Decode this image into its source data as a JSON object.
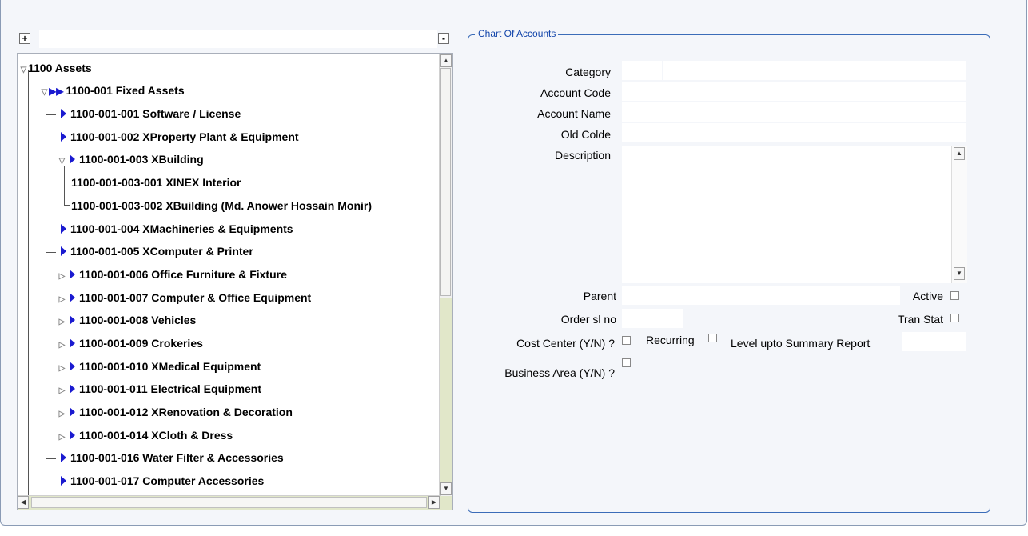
{
  "tree": {
    "expand_all_label": "+",
    "collapse_all_label": "-",
    "search_value": "",
    "nodes": [
      {
        "label": "1100  Assets"
      },
      {
        "label": "1100-001 Fixed Assets"
      },
      {
        "label": "1100-001-001 Software / License"
      },
      {
        "label": "1100-001-002 XProperty Plant & Equipment"
      },
      {
        "label": "1100-001-003 XBuilding"
      },
      {
        "label": "1100-001-003-001 XINEX Interior"
      },
      {
        "label": "1100-001-003-002 XBuilding (Md. Anower Hossain Monir)"
      },
      {
        "label": "1100-001-004 XMachineries & Equipments"
      },
      {
        "label": "1100-001-005 XComputer & Printer"
      },
      {
        "label": "1100-001-006 Office Furniture & Fixture"
      },
      {
        "label": "1100-001-007 Computer & Office Equipment"
      },
      {
        "label": "1100-001-008 Vehicles"
      },
      {
        "label": "1100-001-009 Crokeries"
      },
      {
        "label": "1100-001-010 XMedical Equipment"
      },
      {
        "label": "1100-001-011 Electrical Equipment"
      },
      {
        "label": "1100-001-012 XRenovation & Decoration"
      },
      {
        "label": "1100-001-014 XCloth & Dress"
      },
      {
        "label": "1100-001-016 Water Filter & Accessories"
      },
      {
        "label": "1100-001-017 Computer Accessories"
      }
    ]
  },
  "form": {
    "title": "Chart Of Accounts",
    "category_label": "Category",
    "account_code_label": "Account Code",
    "account_name_label": "Account Name",
    "old_code_label": "Old Colde",
    "description_label": "Description",
    "parent_label": "Parent",
    "active_label": "Active",
    "order_label": "Order sl no",
    "tran_stat_label": "Tran Stat",
    "cost_center_label": "Cost Center (Y/N) ?",
    "recurring_label": "Recurring",
    "level_label": "Level upto Summary Report",
    "business_area_label": "Business Area (Y/N) ?",
    "values": {
      "category_code": "",
      "category_name": "",
      "account_code": "",
      "account_name": "",
      "old_code": "",
      "description": "",
      "parent": "",
      "order_sl_no": "",
      "level_upto": ""
    }
  }
}
